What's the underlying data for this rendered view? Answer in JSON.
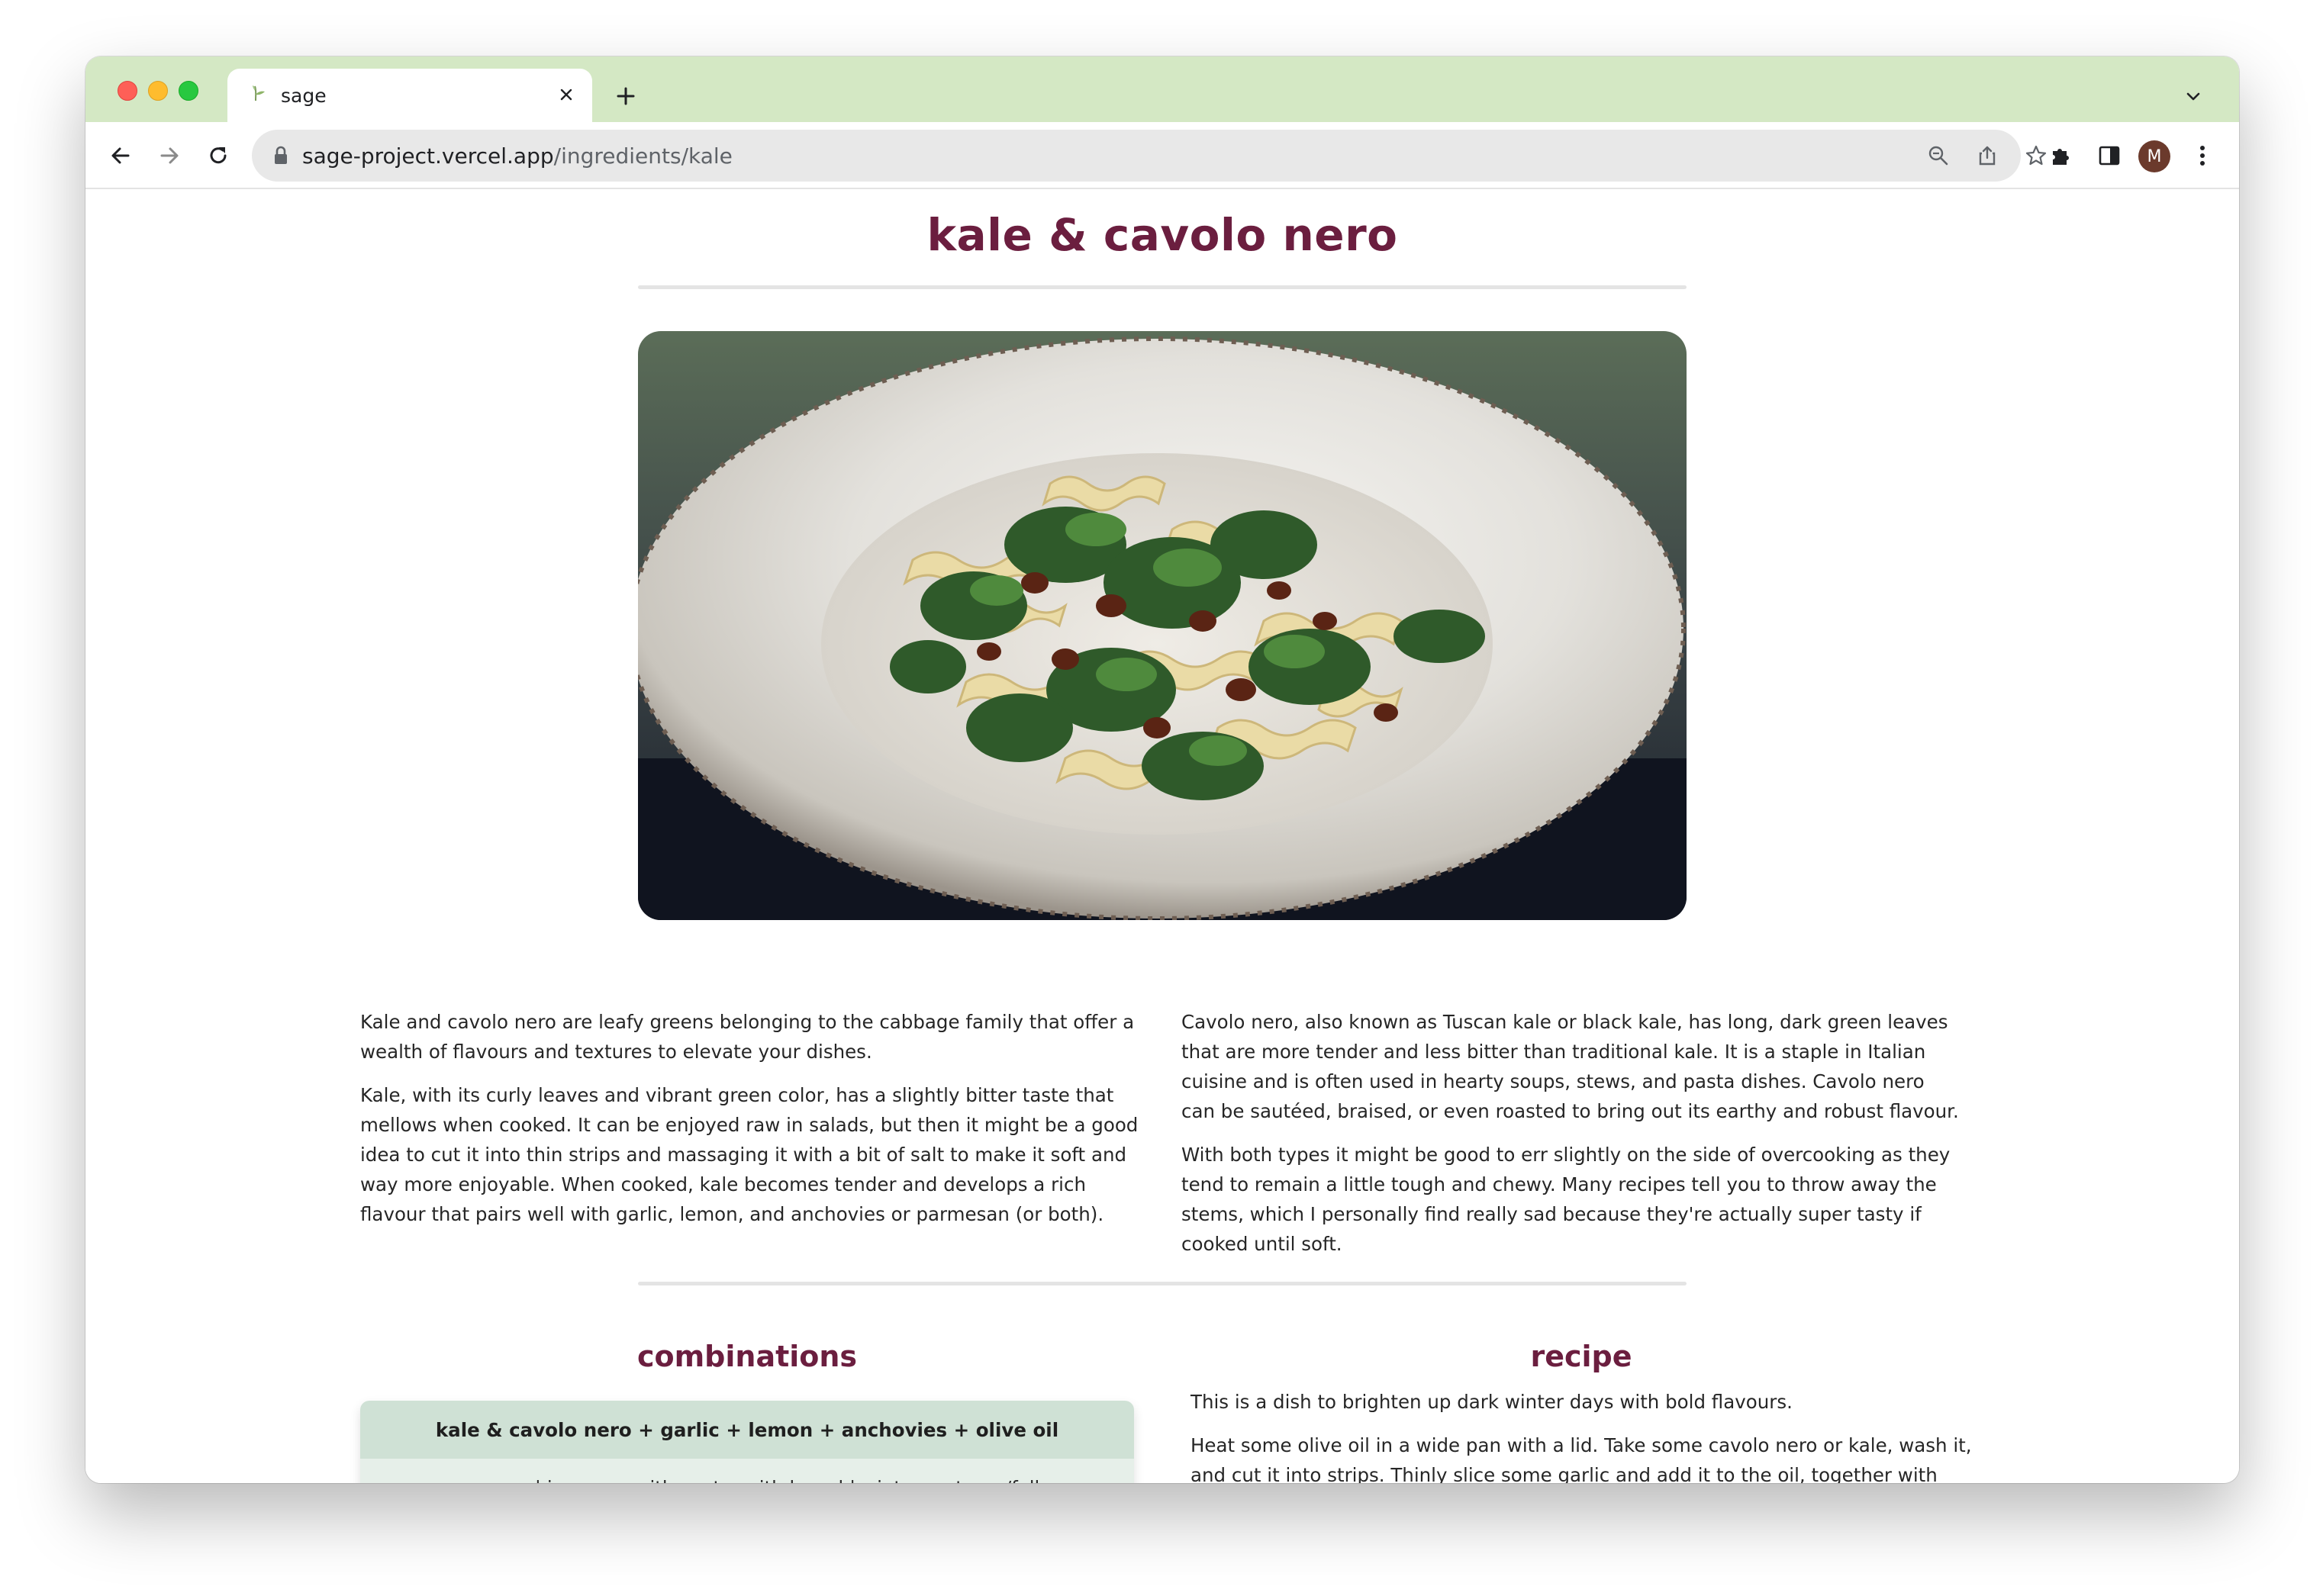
{
  "browser": {
    "tab_title": "sage",
    "url_host": "sage-project.vercel.app",
    "url_path": "/ingredients/kale",
    "avatar_initial": "M",
    "accent_color": "#d4e8c4"
  },
  "page": {
    "title": "kale & cavolo nero",
    "hero_image_alt": "pasta-with-kale-and-raisins",
    "intro_left": [
      "Kale and cavolo nero are leafy greens belonging to the cabbage family that offer a wealth of flavours and textures to elevate your dishes.",
      "Kale, with its curly leaves and vibrant green color, has a slightly bitter taste that mellows when cooked. It can be enjoyed raw in salads, but then it might be a good idea to cut it into thin strips and massaging it with a bit of salt to make it soft and way more enjoyable. When cooked, kale becomes tender and develops a rich flavour that pairs well with garlic, lemon, and anchovies or parmesan (or both)."
    ],
    "intro_right": [
      "Cavolo nero, also known as Tuscan kale or black kale, has long, dark green leaves that are more tender and less bitter than traditional kale. It is a staple in Italian cuisine and is often used in hearty soups, stews, and pasta dishes. Cavolo nero can be sautéed, braised, or even roasted to bring out its earthy and robust flavour.",
      "With both types it might be good to err slightly on the side of overcooking as they tend to remain a little tough and chewy. Many recipes tell you to throw away the stems, which I personally find really sad because they're actually super tasty if cooked until soft."
    ],
    "title_color": "#6b1e3f"
  },
  "combinations": {
    "heading": "combinations",
    "cards": [
      {
        "ingredients": "kale & cavolo nero + garlic + lemon + anchovies + olive oil",
        "tags": "savoury | in a pan, with pasta, with bread | winter, autumn/fall"
      }
    ]
  },
  "recipe": {
    "heading": "recipe",
    "paragraphs": [
      "This is a dish to brighten up dark winter days with bold flavours.",
      "Heat some olive oil in a wide pan with a lid. Take some cavolo nero or kale, wash it, and cut it into strips. Thinly slice some garlic and add it to the oil, together with some anchovies (or leave them out if you want to keep it vegetarian, but they do add quite a bit of depth to the flavour). Keep an eye on it, you don't want the garlic to burn or it'll turn bitter. Once the"
    ]
  }
}
